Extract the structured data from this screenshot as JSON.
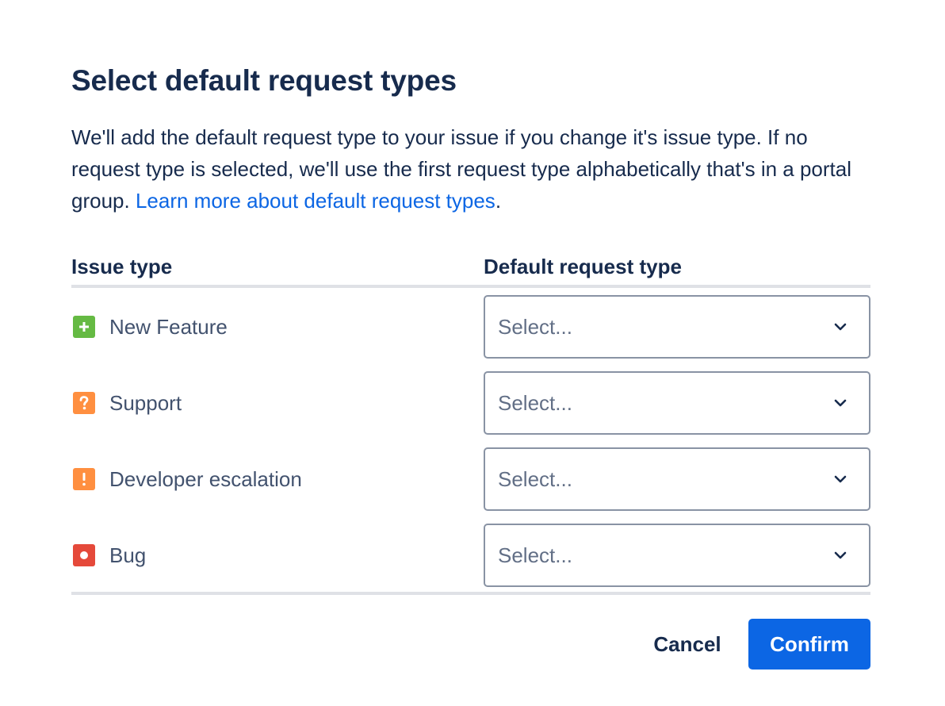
{
  "dialog": {
    "title": "Select default request types",
    "description": {
      "text": "We'll add the default request type to your issue if you change it's issue type. If no request type is selected, we'll use the first request type alphabetically that's in a portal group. ",
      "link_text": "Learn more about default request types",
      "after_link": "."
    },
    "columns": {
      "issue_type": "Issue type",
      "default_request_type": "Default request type"
    },
    "rows": [
      {
        "issue_type": "New Feature",
        "icon": "plus-icon",
        "icon_color": "#65ba43",
        "select_placeholder": "Select..."
      },
      {
        "issue_type": "Support",
        "icon": "question-icon",
        "icon_color": "#ff8f40",
        "select_placeholder": "Select..."
      },
      {
        "issue_type": "Developer escalation",
        "icon": "exclamation-icon",
        "icon_color": "#ff8f40",
        "select_placeholder": "Select..."
      },
      {
        "issue_type": "Bug",
        "icon": "bug-icon",
        "icon_color": "#e5493a",
        "select_placeholder": "Select..."
      }
    ],
    "buttons": {
      "cancel": "Cancel",
      "confirm": "Confirm"
    },
    "colors": {
      "primary": "#0c66e4",
      "text": "#172b4d",
      "link": "#0c66e4"
    }
  }
}
